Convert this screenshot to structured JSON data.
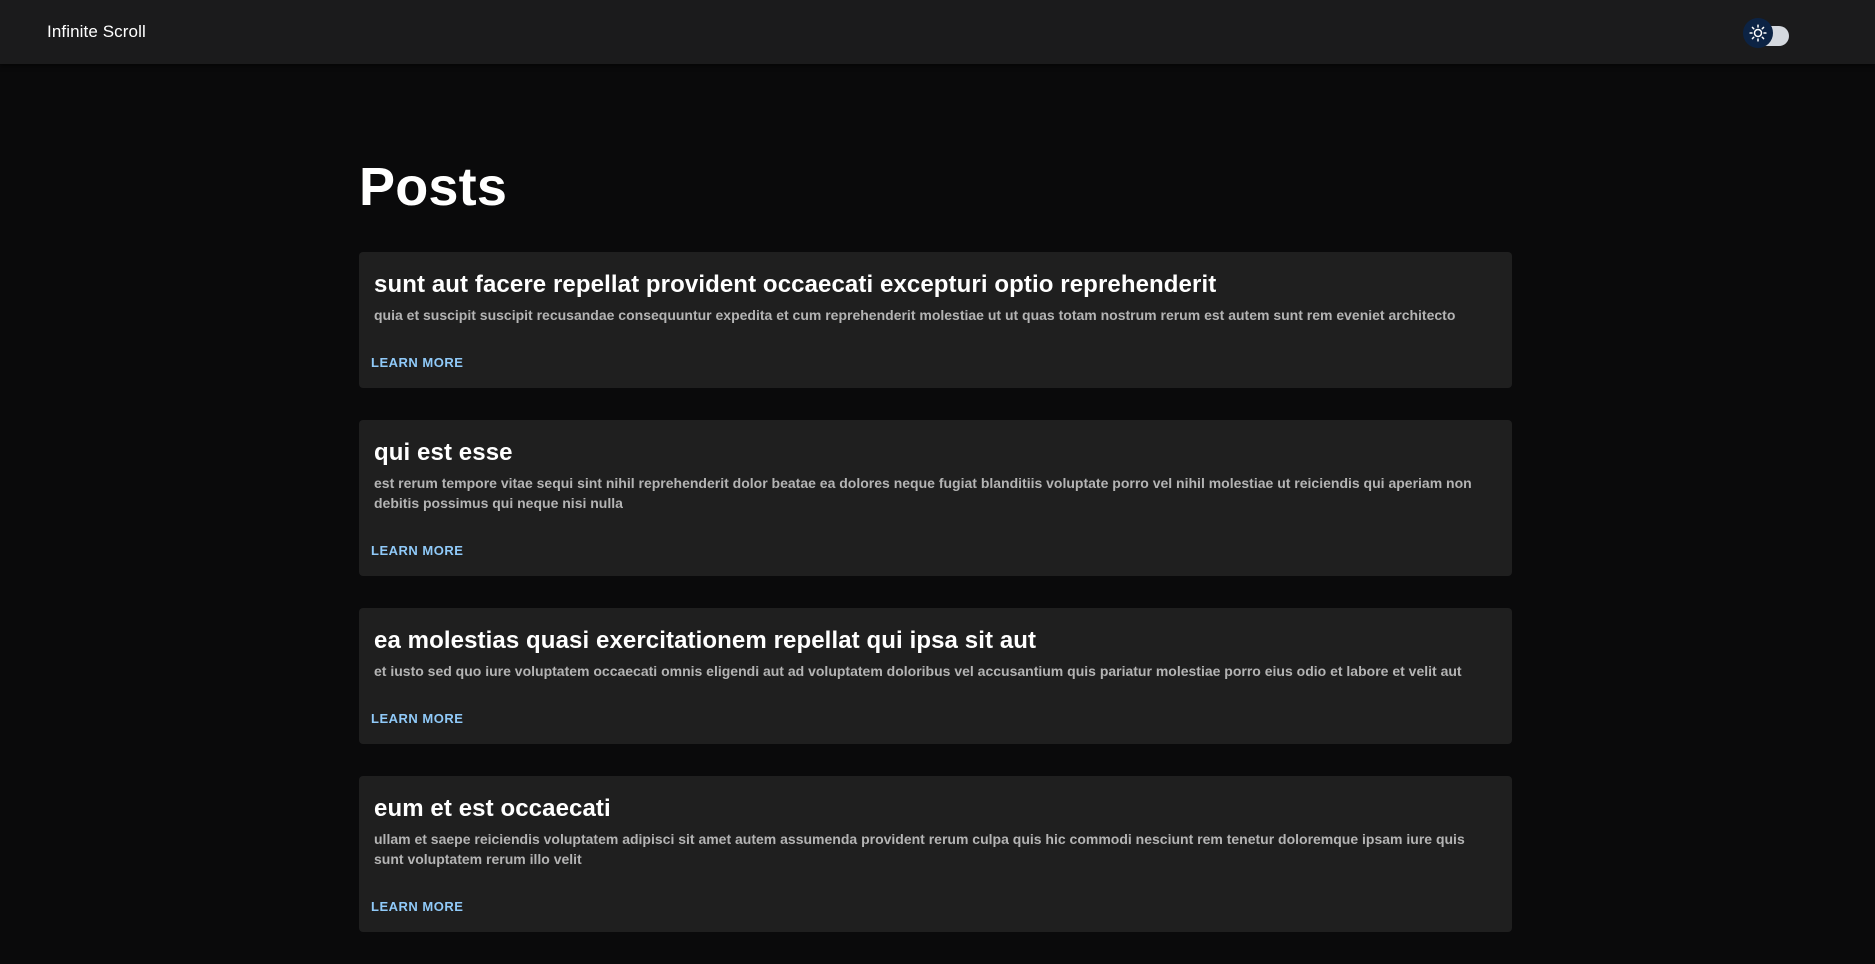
{
  "header": {
    "title": "Infinite Scroll",
    "theme_toggle_icon": "sun-icon"
  },
  "main": {
    "title": "Posts",
    "posts": [
      {
        "title": "sunt aut facere repellat provident occaecati excepturi optio reprehenderit",
        "body": "quia et suscipit suscipit recusandae consequuntur expedita et cum reprehenderit molestiae ut ut quas totam nostrum rerum est autem sunt rem eveniet architecto",
        "action": "LEARN MORE"
      },
      {
        "title": "qui est esse",
        "body": "est rerum tempore vitae sequi sint nihil reprehenderit dolor beatae ea dolores neque fugiat blanditiis voluptate porro vel nihil molestiae ut reiciendis qui aperiam non debitis possimus qui neque nisi nulla",
        "action": "LEARN MORE"
      },
      {
        "title": "ea molestias quasi exercitationem repellat qui ipsa sit aut",
        "body": "et iusto sed quo iure voluptatem occaecati omnis eligendi aut ad voluptatem doloribus vel accusantium quis pariatur molestiae porro eius odio et labore et velit aut",
        "action": "LEARN MORE"
      },
      {
        "title": "eum et est occaecati",
        "body": "ullam et saepe reiciendis voluptatem adipisci sit amet autem assumenda provident rerum culpa quis hic commodi nesciunt rem tenetur doloremque ipsam iure quis sunt voluptatem rerum illo velit",
        "action": "LEARN MORE"
      }
    ]
  },
  "colors": {
    "background": "#0a0a0b",
    "appbar": "#1b1b1c",
    "card": "#1f1f1f",
    "link": "#90caf9",
    "toggle_thumb": "#0c2344",
    "toggle_track": "#d5d9df"
  }
}
